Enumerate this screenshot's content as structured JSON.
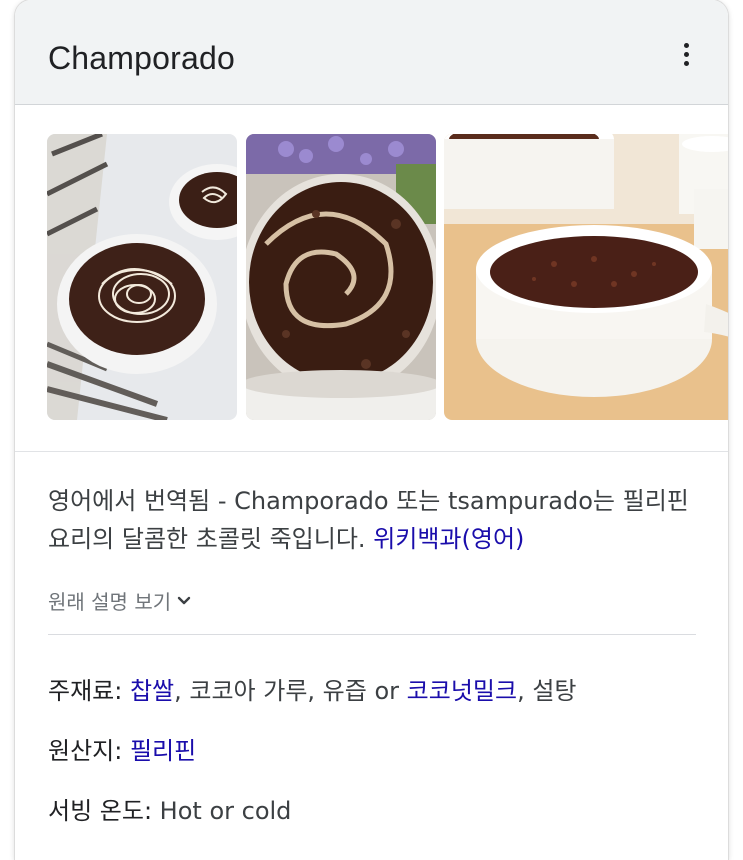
{
  "card": {
    "title": "Champorado",
    "menu_icon": "more-vert-icon"
  },
  "images": [
    {
      "alt": "champorado bowl with swirl",
      "icon": "food-photo"
    },
    {
      "alt": "champorado close up",
      "icon": "food-photo"
    },
    {
      "alt": "champorado in white pan",
      "icon": "food-photo"
    }
  ],
  "description": {
    "prefix": "영어에서 번역됨 - Champorado 또는 tsampurado는 필리핀 요리의 달콤한 초콜릿 죽입니다. ",
    "source_link": "위키백과(영어)",
    "show_original": "원래 설명 보기"
  },
  "facts": {
    "ingredients": {
      "label": "주재료: ",
      "items": [
        {
          "text": "찹쌀",
          "link": true
        },
        {
          "text": ", 코코아 가루, 유즙 or ",
          "link": false
        },
        {
          "text": "코코넛밀크",
          "link": true
        },
        {
          "text": ", 설탕",
          "link": false
        }
      ]
    },
    "origin": {
      "label": "원산지: ",
      "value": "필리핀"
    },
    "serving": {
      "label": "서빙 온도: ",
      "value": "Hot or cold"
    }
  },
  "colors": {
    "link": "#1a0dab",
    "header_bg": "#f1f3f4",
    "text": "#202124"
  }
}
